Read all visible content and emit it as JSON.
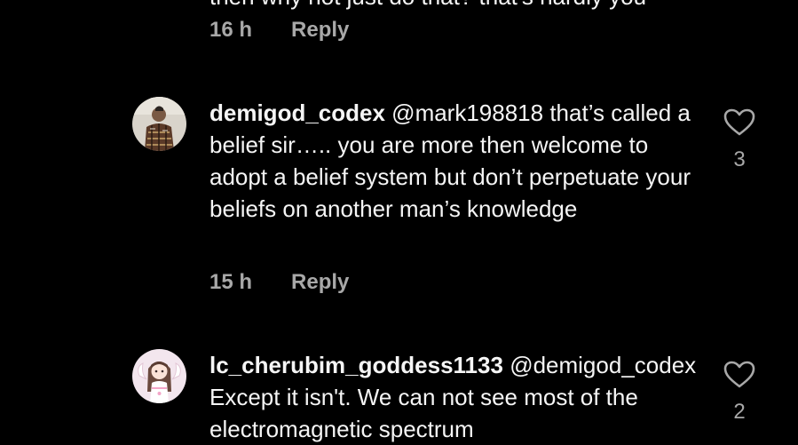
{
  "top_partial": {
    "text": "then why not just do that? that's hardly you"
  },
  "comments": [
    {
      "time": "16 h",
      "reply_label": "Reply"
    },
    {
      "username": "demigod_codex",
      "text": "@mark198818 that’s called a belief sir….. you are more then welcome to adopt a belief system but don’t perpetuate your beliefs on another man’s knowledge",
      "time": "15 h",
      "reply_label": "Reply",
      "likes": "3",
      "avatar_icon": "person-plaid-shirt-photo"
    },
    {
      "username": "lc_cherubim_goddess1133",
      "text": "@demigod_codex Except it isn't. We can not see most of the electromagnetic spectrum",
      "likes": "2",
      "avatar_icon": "anime-girl-avatar"
    }
  ],
  "colors": {
    "background": "#000000",
    "text": "#f5f5f5",
    "secondary": "#a8a8a8"
  }
}
